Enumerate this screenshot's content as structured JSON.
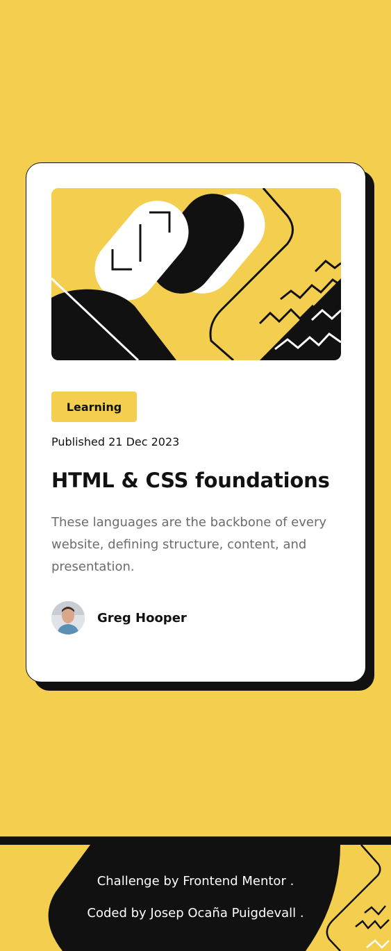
{
  "card": {
    "tag": "Learning",
    "published": "Published 21 Dec 2023",
    "title": "HTML & CSS foundations",
    "description": "These languages are the backbone of every website, defining structure, content, and presentation.",
    "author": "Greg Hooper"
  },
  "footer": {
    "line1": "Challenge by Frontend Mentor .",
    "line2": "Coded by Josep Ocaña Puigdevall ."
  },
  "colors": {
    "background": "#f4ce4f",
    "ink": "#111111",
    "card": "#ffffff",
    "muted": "#6b6b6b"
  },
  "icons": [
    "hero-illustration",
    "avatar"
  ]
}
